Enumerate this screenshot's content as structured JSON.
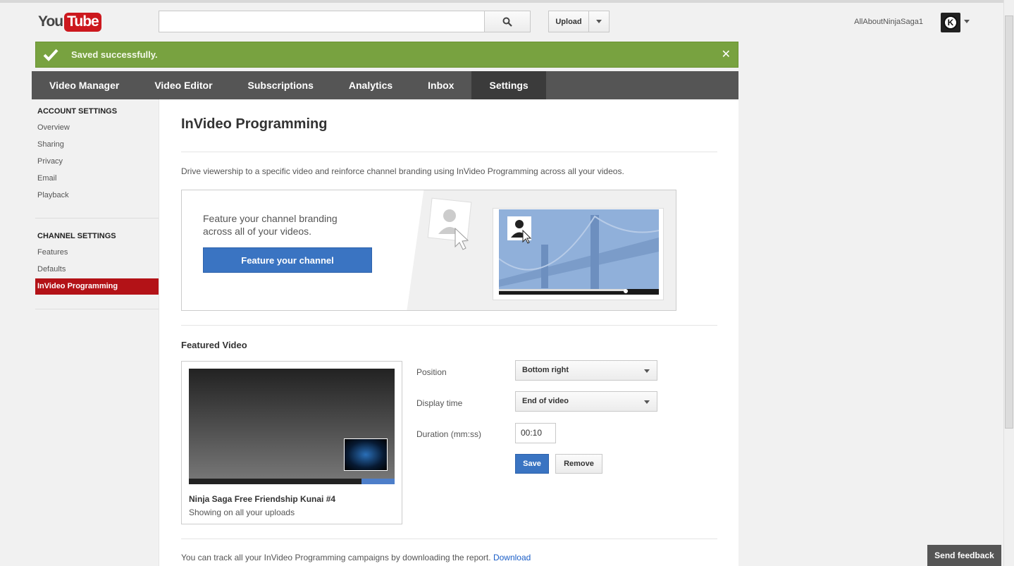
{
  "header": {
    "logo_you": "You",
    "logo_tube": "Tube",
    "search_placeholder": "",
    "upload_label": "Upload",
    "username": "AllAboutNinjaSaga1",
    "avatar_letter": "K"
  },
  "alert": {
    "message": "Saved successfully.",
    "close": "✕",
    "color": "#78a240"
  },
  "nav": {
    "tabs": [
      "Video Manager",
      "Video Editor",
      "Subscriptions",
      "Analytics",
      "Inbox",
      "Settings"
    ],
    "active": "Settings"
  },
  "sidebar": {
    "account_heading": "ACCOUNT SETTINGS",
    "account_items": [
      "Overview",
      "Sharing",
      "Privacy",
      "Email",
      "Playback"
    ],
    "channel_heading": "CHANNEL SETTINGS",
    "channel_items": [
      "Features",
      "Defaults",
      "InVideo Programming"
    ],
    "active_item": "InVideo Programming"
  },
  "main": {
    "title": "InVideo Programming",
    "description": "Drive viewership to a specific video and reinforce channel branding using InVideo Programming across all your videos.",
    "promo": {
      "text": "Feature your channel branding across all of your videos.",
      "button": "Feature your channel"
    },
    "featured": {
      "heading": "Featured Video",
      "video_title": "Ninja Saga Free Friendship Kunai #4",
      "video_subtitle": "Showing on all your uploads",
      "progress": 0.84
    },
    "form": {
      "position_label": "Position",
      "position_value": "Bottom right",
      "display_label": "Display time",
      "display_value": "End of video",
      "duration_label": "Duration (mm:ss)",
      "duration_value": "00:10",
      "save": "Save",
      "remove": "Remove"
    },
    "footer_text": "You can track all your InVideo Programming campaigns by downloading the report.",
    "footer_link": "Download"
  },
  "feedback": "Send feedback"
}
